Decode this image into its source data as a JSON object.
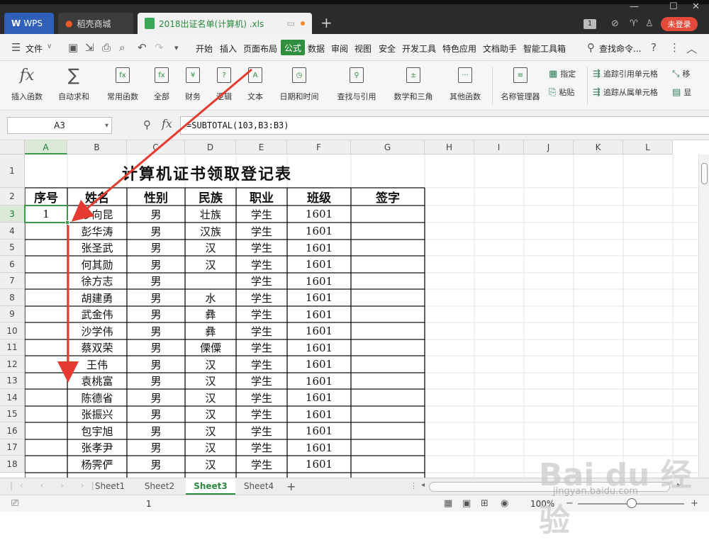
{
  "window": {
    "tabs": [
      {
        "label": "WPS"
      },
      {
        "label": "稻壳商城"
      },
      {
        "label": "2018出证名单(计算机) .xls"
      }
    ],
    "login_label": "未登录",
    "badge": "1"
  },
  "menu": {
    "file_label": "文件",
    "items": [
      "开始",
      "插入",
      "页面布局",
      "公式",
      "数据",
      "审阅",
      "视图",
      "安全",
      "开发工具",
      "特色应用",
      "文档助手",
      "智能工具箱"
    ],
    "active": "公式",
    "search_label": "查找命令..."
  },
  "ribbon": {
    "buttons": [
      "插入函数",
      "自动求和",
      "常用函数",
      "全部",
      "财务",
      "逻辑",
      "文本",
      "日期和时间",
      "查找与引用",
      "数学和三角",
      "其他函数",
      "名称管理器"
    ],
    "small": [
      "指定",
      "粘贴",
      "追踪引用单元格",
      "追踪从属单元格",
      "移",
      "显"
    ]
  },
  "formula_bar": {
    "name_box": "A3",
    "fx": "fx",
    "formula": "=SUBTOTAL(103,B3:B3)"
  },
  "sheet": {
    "columns": [
      "A",
      "B",
      "C",
      "D",
      "E",
      "F",
      "G",
      "H",
      "I",
      "J",
      "K",
      "L"
    ],
    "rows": [
      "1",
      "2",
      "3",
      "4",
      "5",
      "6",
      "7",
      "8",
      "9",
      "10",
      "11",
      "12",
      "13",
      "14",
      "15",
      "16",
      "17",
      "18"
    ],
    "title": "计算机证书领取登记表",
    "headers": [
      "序号",
      "姓名",
      "性别",
      "民族",
      "职业",
      "班级",
      "签字"
    ],
    "data": [
      [
        "1",
        "沙向昆",
        "男",
        "壮族",
        "学生",
        "1601",
        ""
      ],
      [
        "",
        "彭华涛",
        "男",
        "汉族",
        "学生",
        "1601",
        ""
      ],
      [
        "",
        "张圣武",
        "男",
        "汉",
        "学生",
        "1601",
        ""
      ],
      [
        "",
        "何其勋",
        "男",
        "汉",
        "学生",
        "1601",
        ""
      ],
      [
        "",
        "徐方志",
        "男",
        "",
        "学生",
        "1601",
        ""
      ],
      [
        "",
        "胡建勇",
        "男",
        "水",
        "学生",
        "1601",
        ""
      ],
      [
        "",
        "武金伟",
        "男",
        "彝",
        "学生",
        "1601",
        ""
      ],
      [
        "",
        "沙学伟",
        "男",
        "彝",
        "学生",
        "1601",
        ""
      ],
      [
        "",
        "蔡双荣",
        "男",
        "傈僳",
        "学生",
        "1601",
        ""
      ],
      [
        "",
        "王伟",
        "男",
        "汉",
        "学生",
        "1601",
        ""
      ],
      [
        "",
        "袁桃富",
        "男",
        "汉",
        "学生",
        "1601",
        ""
      ],
      [
        "",
        "陈德省",
        "男",
        "汉",
        "学生",
        "1601",
        ""
      ],
      [
        "",
        "张振兴",
        "男",
        "汉",
        "学生",
        "1601",
        ""
      ],
      [
        "",
        "包宇旭",
        "男",
        "汉",
        "学生",
        "1601",
        ""
      ],
      [
        "",
        "张孝尹",
        "男",
        "汉",
        "学生",
        "1601",
        ""
      ],
      [
        "",
        "杨霁俨",
        "男",
        "汉",
        "学生",
        "1601",
        ""
      ]
    ]
  },
  "sheet_tabs": [
    "Sheet1",
    "Sheet2",
    "Sheet3",
    "Sheet4"
  ],
  "active_sheet": "Sheet3",
  "status": {
    "count": "1",
    "zoom": "100%"
  },
  "watermark": {
    "text": "Bai du 经验",
    "sub": "jingyan.baidu.com"
  },
  "colors": {
    "accent": "#2f8f3f",
    "annotation_arrow": "#e53a2f"
  }
}
